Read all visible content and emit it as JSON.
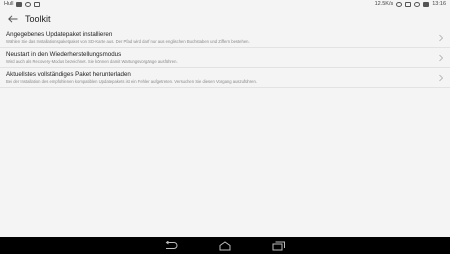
{
  "status_bar": {
    "left_text": "Hull",
    "speed": "12.5K/s",
    "time": "13:16"
  },
  "app_bar": {
    "title": "Toolkit"
  },
  "items": [
    {
      "title": "Angegebenes Updatepaket installieren",
      "description": "Wählen Sie das Installationspaketpaket von SD-Karte aus. Der Pfad wird darf nur aus englischen Buchstaben und Ziffern bestehen."
    },
    {
      "title": "Neustart in den Wiederherstellungsmodus",
      "description": "Wird auch als Recovery-Modus bezeichnet. Sie können damit Wartungsvorgänge ausführen."
    },
    {
      "title": "Aktuellstes vollständiges Paket herunterladen",
      "description": "Bei der Installation des empfohlenen kompatiblen Updatepakets ist ein Fehler aufgetreten. Versuchen Sie diesen Vorgang auszuführen."
    }
  ],
  "colors": {
    "background": "#f4f4f4",
    "nav_bar": "#000000",
    "divider": "#e2e2e2",
    "title_text": "#222222",
    "desc_text": "#8a8a8a"
  },
  "icons": {
    "back": "arrow-left-icon",
    "chevron": "chevron-right-icon",
    "nav_back": "back-icon",
    "nav_home": "home-icon",
    "nav_recents": "recents-icon"
  }
}
